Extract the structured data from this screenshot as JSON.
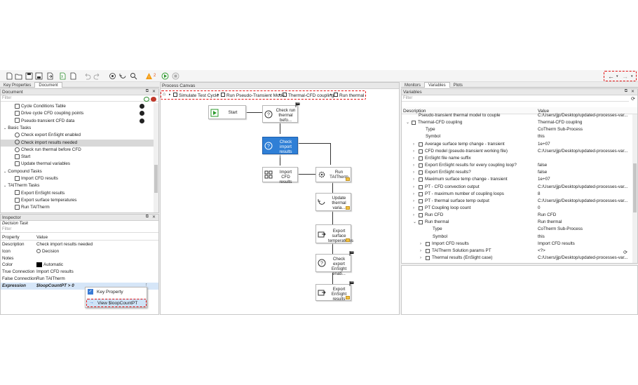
{
  "toolbar": {
    "warning_count": "2",
    "icons": [
      "new-icon",
      "open-icon",
      "save-icon",
      "save-as-icon",
      "export-icon",
      "import-icon",
      "undo-icon",
      "redo-icon",
      "target-icon",
      "refresh-icon",
      "zoom-icon",
      "warning-icon",
      "run-icon",
      "stop-icon",
      "back-icon",
      "forward-icon"
    ]
  },
  "left_tabs": [
    "Key Properties",
    "Document"
  ],
  "document": {
    "title": "Document",
    "filter": "Filter",
    "items": [
      {
        "label": "Cycle Conditions Table",
        "indent": 2,
        "icon": "table-icon"
      },
      {
        "label": "Drive cycle CFD coupling points",
        "indent": 2,
        "icon": "table-icon"
      },
      {
        "label": "Pseudo-transient CFD data",
        "indent": 2,
        "icon": "table-icon"
      },
      {
        "label": "Basic Tasks",
        "indent": 1,
        "icon": "chevron-icon"
      },
      {
        "label": "Check export EnSight enabled",
        "indent": 2,
        "icon": "decision-icon"
      },
      {
        "label": "Check import results needed",
        "indent": 2,
        "icon": "decision-icon"
      },
      {
        "label": "Check run thermal before CFD",
        "indent": 2,
        "icon": "decision-icon"
      },
      {
        "label": "Start",
        "indent": 2,
        "icon": "start-icon"
      },
      {
        "label": "Update thermal variables",
        "indent": 2,
        "icon": "update-icon"
      },
      {
        "label": "Compound Tasks",
        "indent": 1,
        "icon": "chevron-icon"
      },
      {
        "label": "Import CFD results",
        "indent": 2,
        "icon": "compound-icon"
      },
      {
        "label": "TAITherm Tasks",
        "indent": 1,
        "icon": "chevron-icon"
      },
      {
        "label": "Export EnSight results",
        "indent": 2,
        "icon": "export-icon"
      },
      {
        "label": "Export surface temperatures",
        "indent": 2,
        "icon": "export-icon"
      },
      {
        "label": "Run TAITherm",
        "indent": 2,
        "icon": "gear-icon"
      }
    ]
  },
  "inspector": {
    "title": "Inspector",
    "subtitle": "Decision Task",
    "filter": "Filter",
    "col_property": "Property",
    "col_value": "Value",
    "rows": [
      {
        "property": "Description",
        "value": "Check import results needed"
      },
      {
        "property": "Icon",
        "value": "Decision"
      },
      {
        "property": "Notes",
        "value": ""
      },
      {
        "property": "Color",
        "value": "Automatic"
      },
      {
        "property": "True Connection",
        "value": "Import CFD results"
      },
      {
        "property": "False Connection",
        "value": "Run TAITherm"
      },
      {
        "property": "Expression",
        "value": "$loopCountPT > 0"
      }
    ],
    "context_menu": [
      "Key Property",
      "View $loopCountPT"
    ]
  },
  "canvas": {
    "title": "Process Canvas",
    "breadcrumb": [
      "Simulate Test Cycle",
      "Run Pseudo-Transient Mode",
      "Thermal-CFD coupling",
      "Run thermal"
    ],
    "nodes": {
      "start": "Start",
      "check_run": "Check run thermal befo...",
      "check_import": "Check import results needed",
      "import_cfd": "Import CFD results",
      "run_taitherm": "Run TAITherm",
      "update": "Update thermal varia...",
      "export_surface": "Export surface temperatures",
      "check_export": "Check export EnSight enab...",
      "export_ensight": "Export EnSight results"
    }
  },
  "right_tabs": [
    "Monitors",
    "Variables",
    "Plots"
  ],
  "variables": {
    "title": "Variables",
    "filter": "Filter",
    "col_description": "Description",
    "col_value": "Value",
    "rows": [
      {
        "desc": "Pseudo-transient thermal model to couple",
        "value": "C:/Users/jjp/Desktop/updated-processes-var...",
        "indent": 2
      },
      {
        "desc": "Thermal-CFD coupling",
        "value": "Thermal-CFD coupling",
        "indent": 1,
        "exp": "v"
      },
      {
        "desc": "Type",
        "value": "CoTherm Sub-Process",
        "indent": 3
      },
      {
        "desc": "Symbol",
        "value": "this",
        "indent": 3
      },
      {
        "desc": "Average surface temp change - transient",
        "value": "1e+07",
        "indent": 2,
        "exp": ">"
      },
      {
        "desc": "CFD model (pseudo-transient working file)",
        "value": "C:/Users/jjp/Desktop/updated-processes-var...",
        "indent": 2,
        "exp": ">"
      },
      {
        "desc": "EnSight file name suffix",
        "value": "",
        "indent": 2,
        "exp": ">"
      },
      {
        "desc": "Export EnSight results for every coupling loop?",
        "value": "false",
        "indent": 2,
        "exp": ">"
      },
      {
        "desc": "Export EnSight results?",
        "value": "false",
        "indent": 2,
        "exp": ">"
      },
      {
        "desc": "Maximum surface temp change - transient",
        "value": "1e+07",
        "indent": 2,
        "exp": ">"
      },
      {
        "desc": "PT - CFD convection output",
        "value": "C:/Users/jjp/Desktop/updated-processes-var...",
        "indent": 2,
        "exp": ">"
      },
      {
        "desc": "PT - maximum number of coupling loops",
        "value": "8",
        "indent": 2,
        "exp": ">"
      },
      {
        "desc": "PT - thermal surface temp output",
        "value": "C:/Users/jjp/Desktop/updated-processes-var...",
        "indent": 2,
        "exp": ">"
      },
      {
        "desc": "PT Coupling loop count",
        "value": "0",
        "indent": 2,
        "exp": ">"
      },
      {
        "desc": "Run CFD",
        "value": "Run CFD",
        "indent": 2,
        "exp": ">"
      },
      {
        "desc": "Run thermal",
        "value": "Run thermal",
        "indent": 2,
        "exp": "v"
      },
      {
        "desc": "Type",
        "value": "CoTherm Sub-Process",
        "indent": 4
      },
      {
        "desc": "Symbol",
        "value": "this",
        "indent": 4
      },
      {
        "desc": "Import CFD results",
        "value": "Import CFD results",
        "indent": 3,
        "exp": ">"
      },
      {
        "desc": "TAITherm Solution params PT",
        "value": "<?>",
        "indent": 3,
        "exp": ">"
      },
      {
        "desc": "Thermal results (EnSight case)",
        "value": "C:/Users/jjp/Desktop/updated-processes-var...",
        "indent": 3,
        "exp": ">"
      }
    ]
  }
}
